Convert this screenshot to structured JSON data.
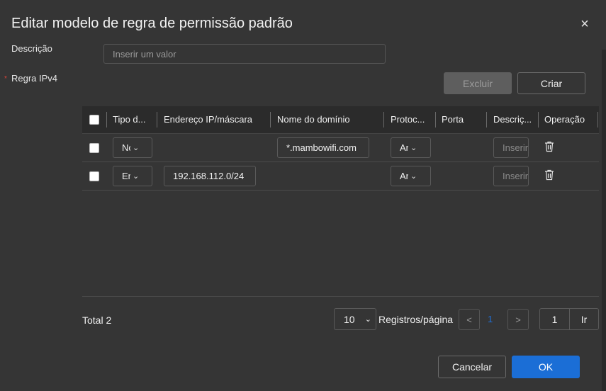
{
  "dialog": {
    "title": "Editar modelo de regra de permissão padrão",
    "close_label": "×"
  },
  "form": {
    "description_label": "Descrição",
    "description_placeholder": "Inserir um valor",
    "required_marker": "*",
    "rule_label": "Regra IPv4"
  },
  "toolbar": {
    "delete_label": "Excluir",
    "create_label": "Criar"
  },
  "table": {
    "columns": [
      "Tipo d...",
      "Endereço IP/máscara",
      "Nome do domínio",
      "Protoc...",
      "Porta",
      "Descriç...",
      "Operação"
    ],
    "rows": [
      {
        "type": "Nome de domínio",
        "ip_mask": "",
        "domain": "*.mambowifi.com",
        "protocol": "Any",
        "port": "",
        "description_placeholder": "Inserir",
        "checked": false
      },
      {
        "type": "Endereço IP",
        "ip_mask": "192.168.112.0/24",
        "domain": "",
        "protocol": "Any",
        "port": "",
        "description_placeholder": "Inserir",
        "checked": false
      }
    ]
  },
  "pagination": {
    "total": "Total 2",
    "page_size": "10",
    "per_page_label": "Registros/página",
    "prev": "<",
    "current_page": "1",
    "next": ">",
    "goto_value": "1",
    "goto_label": "Ir"
  },
  "footer": {
    "cancel_label": "Cancelar",
    "ok_label": "OK"
  },
  "colors": {
    "background": "#353535",
    "accent": "#1b6ed6",
    "required": "#e0453a",
    "disabled_button": "#5e5e5e"
  }
}
